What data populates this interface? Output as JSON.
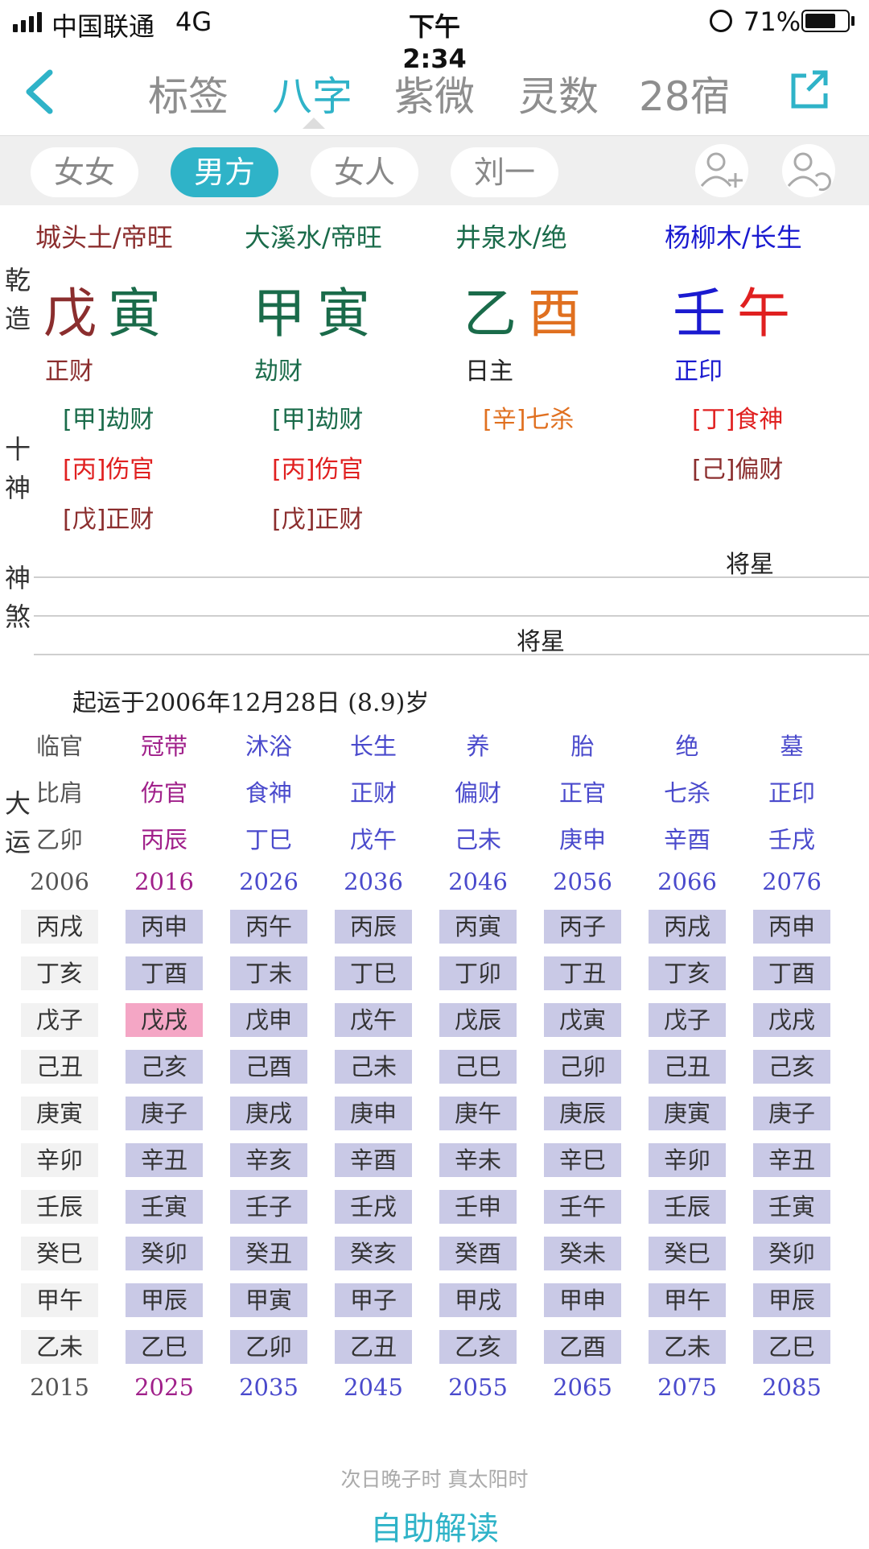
{
  "status_bar": {
    "carrier": "中国联通",
    "network": "4G",
    "time": "下午2:34",
    "battery": "71%",
    "battery_level": 0.71
  },
  "nav": {
    "back_icon": "chevron-left-icon",
    "share_icon": "share-icon",
    "tabs": [
      {
        "label": "标签",
        "active": false
      },
      {
        "label": "八字",
        "active": true
      },
      {
        "label": "紫微",
        "active": false
      },
      {
        "label": "灵数",
        "active": false
      },
      {
        "label": "28宿",
        "active": false
      }
    ]
  },
  "profiles": [
    {
      "label": "女女",
      "active": false
    },
    {
      "label": "男方",
      "active": true
    },
    {
      "label": "女人",
      "active": false
    },
    {
      "label": "刘一",
      "active": false
    }
  ],
  "profile_actions": [
    "add-person-icon",
    "switch-person-icon"
  ],
  "bazi": {
    "side_label_1": "乾造",
    "side_label_2": "十神",
    "side_label_3": "神煞",
    "pillars": [
      {
        "nayin": "城头土/帝旺",
        "nayin_color": "#8b2e2e",
        "stem": "戊",
        "branch": "寅",
        "stem_color": "#8b2e2e",
        "branch_color": "#1a6b4a",
        "shishen": "正财",
        "shishen_color": "#8b2e2e"
      },
      {
        "nayin": "大溪水/帝旺",
        "nayin_color": "#1a6b4a",
        "stem": "甲",
        "branch": "寅",
        "stem_color": "#1a6b4a",
        "branch_color": "#1a6b4a",
        "shishen": "劫财",
        "shishen_color": "#1a6b4a"
      },
      {
        "nayin": "井泉水/绝",
        "nayin_color": "#1a6b4a",
        "stem": "乙",
        "branch": "酉",
        "stem_color": "#1a6b4a",
        "branch_color": "#e07020",
        "shishen": "日主",
        "shishen_color": "#222"
      },
      {
        "nayin": "杨柳木/长生",
        "nayin_color": "#1a1ad0",
        "stem": "壬",
        "branch": "午",
        "stem_color": "#1a1ad0",
        "branch_color": "#e02020",
        "shishen": "正印",
        "shishen_color": "#1a1ad0"
      }
    ],
    "hidden": [
      [
        {
          "text": "[甲]劫财",
          "color": "#1a6b4a"
        },
        {
          "text": "[丙]伤官",
          "color": "#e02020"
        },
        {
          "text": "[戊]正财",
          "color": "#8b2e2e"
        }
      ],
      [
        {
          "text": "[甲]劫财",
          "color": "#1a6b4a"
        },
        {
          "text": "[丙]伤官",
          "color": "#e02020"
        },
        {
          "text": "[戊]正财",
          "color": "#8b2e2e"
        }
      ],
      [
        {
          "text": "[辛]七杀",
          "color": "#e07020"
        }
      ],
      [
        {
          "text": "[丁]食神",
          "color": "#e02020"
        },
        {
          "text": "[己]偏财",
          "color": "#8b2e2e"
        }
      ]
    ],
    "shensha_1": "将星",
    "shensha_2": "将星"
  },
  "dayun": {
    "side_label": "大运",
    "start_text": "起运于2006年12月28日 (8.9)岁",
    "col_colors": [
      "#555555",
      "#a0208a",
      "#4a4acc",
      "#4a4acc",
      "#4a4acc",
      "#4a4acc",
      "#4a4acc",
      "#4a4acc"
    ],
    "changsheng": [
      "临官",
      "冠带",
      "沐浴",
      "长生",
      "养",
      "胎",
      "绝",
      "墓"
    ],
    "shishen": [
      "比肩",
      "伤官",
      "食神",
      "正财",
      "偏财",
      "正官",
      "七杀",
      "正印"
    ],
    "ganzhi": [
      "乙卯",
      "丙辰",
      "丁巳",
      "戊午",
      "己未",
      "庚申",
      "辛酉",
      "壬戌"
    ],
    "start_years": [
      "2006",
      "2016",
      "2026",
      "2036",
      "2046",
      "2056",
      "2066",
      "2076"
    ],
    "end_years": [
      "2015",
      "2025",
      "2035",
      "2045",
      "2055",
      "2065",
      "2075",
      "2085"
    ],
    "liunian": [
      [
        "丙戌",
        "丁亥",
        "戊子",
        "己丑",
        "庚寅",
        "辛卯",
        "壬辰",
        "癸巳",
        "甲午",
        "乙未"
      ],
      [
        "丙申",
        "丁酉",
        "戊戌",
        "己亥",
        "庚子",
        "辛丑",
        "壬寅",
        "癸卯",
        "甲辰",
        "乙巳"
      ],
      [
        "丙午",
        "丁未",
        "戊申",
        "己酉",
        "庚戌",
        "辛亥",
        "壬子",
        "癸丑",
        "甲寅",
        "乙卯"
      ],
      [
        "丙辰",
        "丁巳",
        "戊午",
        "己未",
        "庚申",
        "辛酉",
        "壬戌",
        "癸亥",
        "甲子",
        "乙丑"
      ],
      [
        "丙寅",
        "丁卯",
        "戊辰",
        "己巳",
        "庚午",
        "辛未",
        "壬申",
        "癸酉",
        "甲戌",
        "乙亥"
      ],
      [
        "丙子",
        "丁丑",
        "戊寅",
        "己卯",
        "庚辰",
        "辛巳",
        "壬午",
        "癸未",
        "甲申",
        "乙酉"
      ],
      [
        "丙戌",
        "丁亥",
        "戊子",
        "己丑",
        "庚寅",
        "辛卯",
        "壬辰",
        "癸巳",
        "甲午",
        "乙未"
      ],
      [
        "丙申",
        "丁酉",
        "戊戌",
        "己亥",
        "庚子",
        "辛丑",
        "壬寅",
        "癸卯",
        "甲辰",
        "乙巳"
      ]
    ]
  },
  "footer": {
    "note": "次日晚子时 真太阳时",
    "button": "自助解读"
  }
}
